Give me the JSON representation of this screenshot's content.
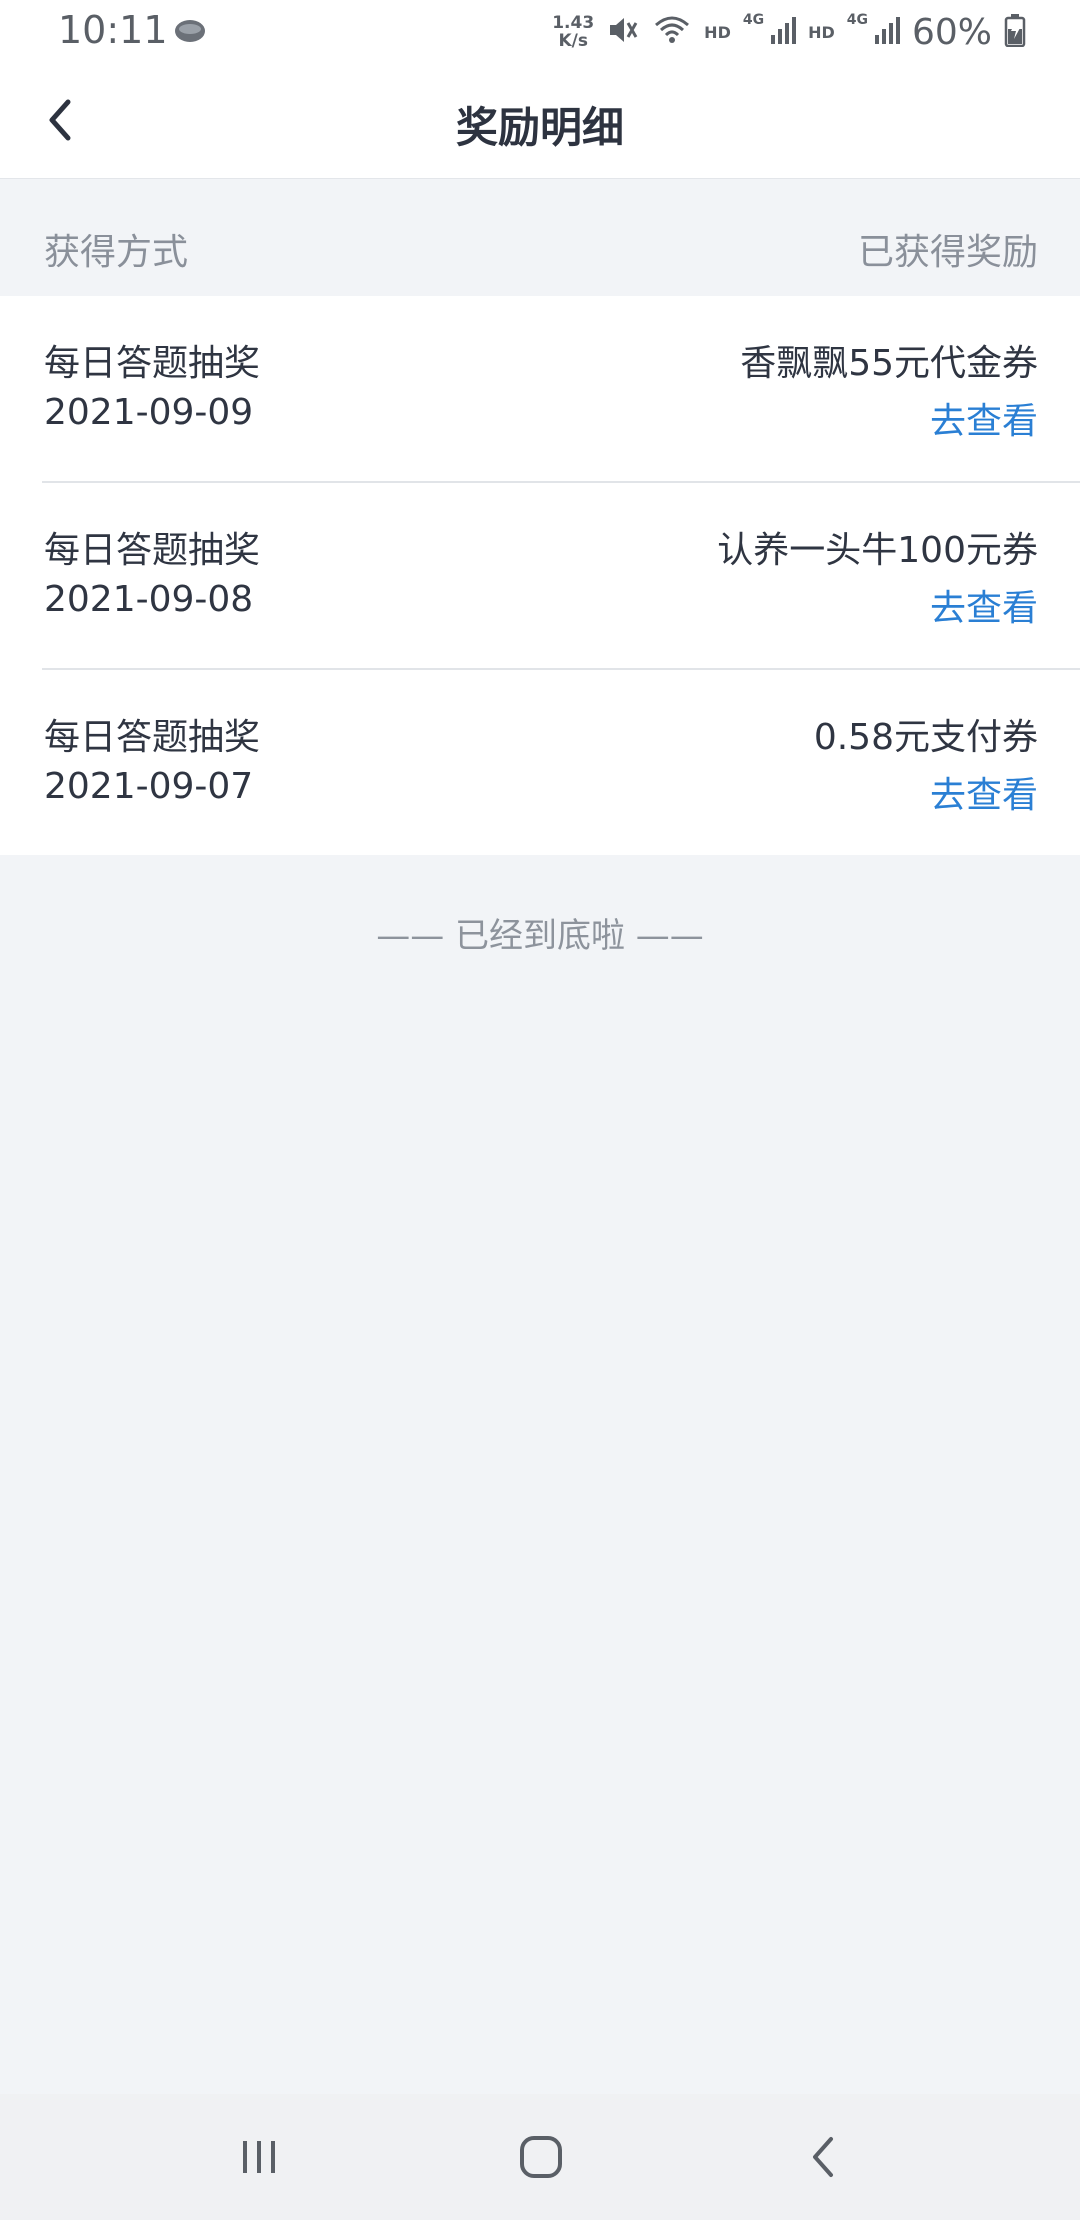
{
  "status_bar": {
    "time": "10:11",
    "network_speed_value": "1.43",
    "network_speed_unit": "K/s",
    "hd1": "HD",
    "net1": "4G",
    "hd2": "HD",
    "net2": "4G",
    "battery": "60%"
  },
  "header": {
    "title": "奖励明细"
  },
  "columns": {
    "left": "获得方式",
    "right": "已获得奖励"
  },
  "rows": [
    {
      "title": "每日答题抽奖",
      "date": "2021-09-09",
      "reward": "香飘飘55元代金券",
      "link": "去查看"
    },
    {
      "title": "每日答题抽奖",
      "date": "2021-09-08",
      "reward": "认养一头牛100元券",
      "link": "去查看"
    },
    {
      "title": "每日答题抽奖",
      "date": "2021-09-07",
      "reward": "0.58元支付券",
      "link": "去查看"
    }
  ],
  "footer": {
    "end_text": "—— 已经到底啦 ——"
  },
  "colors": {
    "link": "#2a7fd4",
    "background": "#f2f4f7"
  }
}
